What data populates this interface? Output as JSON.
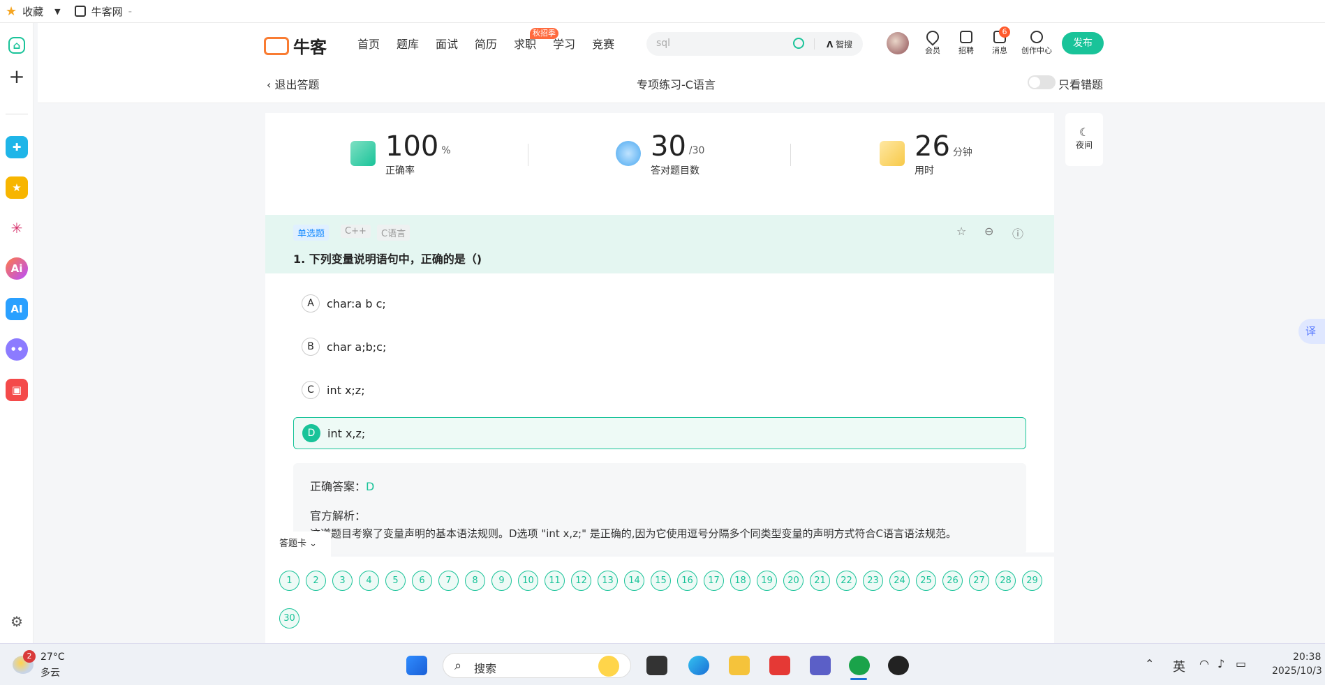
{
  "browser": {
    "favorites_label": "收藏",
    "tab_title": "牛客网",
    "tab_suffix": "-"
  },
  "nav": {
    "logo_text": "牛客",
    "links": [
      "首页",
      "题库",
      "面试",
      "简历",
      "求职",
      "学习",
      "竞赛"
    ],
    "hot_badge": "秋招季",
    "search_placeholder": "sql",
    "ai_search_label": "智搜",
    "icons": [
      {
        "label": "会员",
        "icon": "vip-icon"
      },
      {
        "label": "招聘",
        "icon": "recruit-icon"
      },
      {
        "label": "消息",
        "icon": "message-icon"
      },
      {
        "label": "创作中心",
        "icon": "creator-icon"
      }
    ],
    "message_count": "6",
    "publish_label": "发布"
  },
  "subbar": {
    "back_label": "退出答题",
    "title": "专项练习-C语言",
    "wrong_only_label": "只看错题",
    "wrong_only_on": false
  },
  "stats": [
    {
      "value": "100",
      "unit": "%",
      "label": "正确率",
      "icon": "check-book-icon"
    },
    {
      "value": "30",
      "unit": "/30",
      "label": "答对题目数",
      "icon": "medal-icon"
    },
    {
      "value": "26",
      "unit": "分钟",
      "label": "用时",
      "icon": "clock-doc-icon"
    }
  ],
  "night_mode_label": "夜间",
  "question": {
    "tags": [
      "单选题",
      "C++",
      "C语言"
    ],
    "text": "1. 下列变量说明语句中，正确的是（)",
    "options": [
      {
        "letter": "A",
        "text": "char:a b c;"
      },
      {
        "letter": "B",
        "text": "char a;b;c;"
      },
      {
        "letter": "C",
        "text": "int x;z;"
      },
      {
        "letter": "D",
        "text": "int x,z;",
        "selected": true
      }
    ],
    "answer_label": "正确答案：",
    "answer_value": "D",
    "explanation_label": "官方解析：",
    "explanation_text": "这道题目考察了变量声明的基本语法规则。D选项 \"int x,z;\" 是正确的,因为它使用逗号分隔多个同类型变量的声明方式符合C语言语法规范。"
  },
  "answer_card": {
    "label": "答题卡",
    "numbers": [
      "1",
      "2",
      "3",
      "4",
      "5",
      "6",
      "7",
      "8",
      "9",
      "10",
      "11",
      "12",
      "13",
      "14",
      "15",
      "16",
      "17",
      "18",
      "19",
      "20",
      "21",
      "22",
      "23",
      "24",
      "25",
      "26",
      "27",
      "28",
      "29",
      "30"
    ]
  },
  "translate_label": "译",
  "taskbar": {
    "weather_badge": "2",
    "temperature": "27°C",
    "weather": "多云",
    "search_label": "搜索",
    "ime": "英",
    "time": "20:38",
    "date": "2025/10/3"
  },
  "colors": {
    "accent": "#19c399",
    "orange": "#f97c32"
  }
}
